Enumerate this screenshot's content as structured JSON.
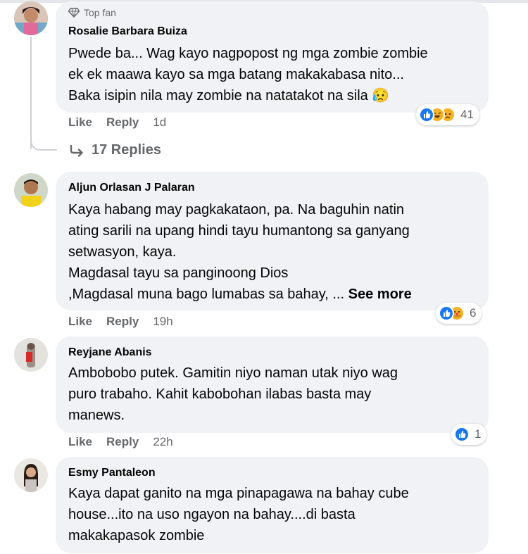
{
  "comments": [
    {
      "author": "Rosalie Barbara Buiza",
      "badge": "Top fan",
      "lines": [
        "Pwede ba... Wag kayo nagpopost ng mga zombie zombie",
        "ek ek maawa kayo sa mga batang makakabasa nito...",
        "Baka isipin nila may zombie na natatakot na sila 😥"
      ],
      "like": "Like",
      "reply": "Reply",
      "time": "1d",
      "reactions": [
        "like-icon",
        "haha-icon",
        "sad-icon"
      ],
      "reaction_count": "41",
      "replies_label": "17 Replies"
    },
    {
      "author": "Aljun Orlasan J Palaran",
      "lines": [
        "Kaya habang may pagkakataon, pa. Na baguhin natin",
        "ating sarili na upang hindi tayu humantong sa ganyang",
        "setwasyon, kaya.",
        "Magdasal tayu sa panginoong Dios",
        ",Magdasal muna bago lumabas sa bahay, ..."
      ],
      "see_more": "See more",
      "like": "Like",
      "reply": "Reply",
      "time": "19h",
      "reactions": [
        "like-icon",
        "care-icon"
      ],
      "reaction_count": "6"
    },
    {
      "author": "Reyjane Abanis",
      "lines": [
        "Ambobobo putek. Gamitin niyo naman utak niyo wag",
        "puro trabaho. Kahit kabobohan ilabas basta may",
        "manews."
      ],
      "like": "Like",
      "reply": "Reply",
      "time": "22h",
      "reactions": [
        "like-icon"
      ],
      "reaction_count": "1"
    },
    {
      "author": "Esmy Pantaleon",
      "lines": [
        "Kaya dapat ganito na mga pinapagawa na bahay cube",
        "house...ito na uso ngayon na bahay....di basta",
        "makakapasok zombie"
      ]
    }
  ],
  "colors": {
    "bubble": "#f0f2f5",
    "secondary_text": "#65676b",
    "like_blue": "#1877f2",
    "care_red": "#f33e58",
    "haha_yellow": "#f7b125"
  }
}
